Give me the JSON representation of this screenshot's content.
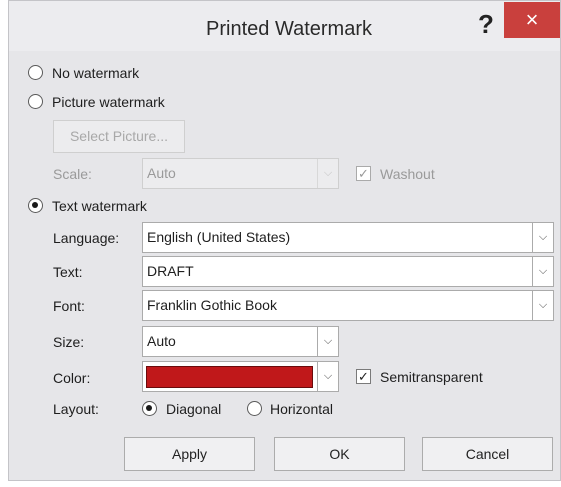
{
  "dialog": {
    "title": "Printed Watermark",
    "help": "?",
    "close": "×"
  },
  "options": {
    "no_watermark": "No watermark",
    "picture_watermark": "Picture watermark",
    "text_watermark": "Text watermark",
    "selected": "text_watermark"
  },
  "picture": {
    "select_button": "Select Picture...",
    "scale_label": "Scale:",
    "scale_value": "Auto",
    "washout_label": "Washout",
    "washout_checked": true
  },
  "text": {
    "language_label": "Language:",
    "language_value": "English (United States)",
    "text_label": "Text:",
    "text_value": "DRAFT",
    "font_label": "Font:",
    "font_value": "Franklin Gothic Book",
    "size_label": "Size:",
    "size_value": "Auto",
    "color_label": "Color:",
    "color_value": "#c0181a",
    "semitransparent_label": "Semitransparent",
    "semitransparent_checked": true,
    "layout_label": "Layout:",
    "diagonal_label": "Diagonal",
    "horizontal_label": "Horizontal",
    "layout_selected": "Diagonal"
  },
  "buttons": {
    "apply": "Apply",
    "ok": "OK",
    "cancel": "Cancel"
  },
  "icons": {
    "dropdown": "chevron-down-icon",
    "check": "check-icon"
  }
}
